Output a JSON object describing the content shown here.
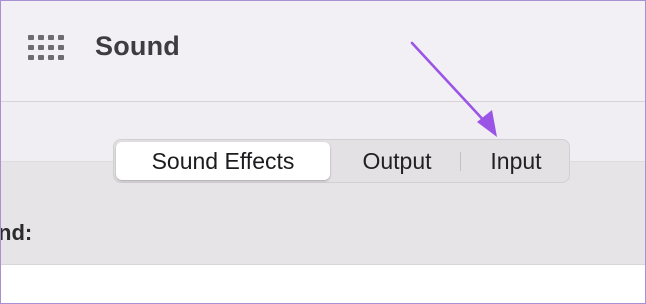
{
  "window": {
    "title": "Sound"
  },
  "tabs": [
    {
      "label": "Sound Effects",
      "selected": true
    },
    {
      "label": "Output",
      "selected": false
    },
    {
      "label": "Input",
      "selected": false
    }
  ],
  "content": {
    "partial_label": "nd:"
  },
  "icons": {
    "app_grid": "grid-icon",
    "annotation": "pointer-arrow-icon"
  },
  "colors": {
    "annotation_arrow": "#9b55e6",
    "frame_border": "#a98fd3"
  }
}
